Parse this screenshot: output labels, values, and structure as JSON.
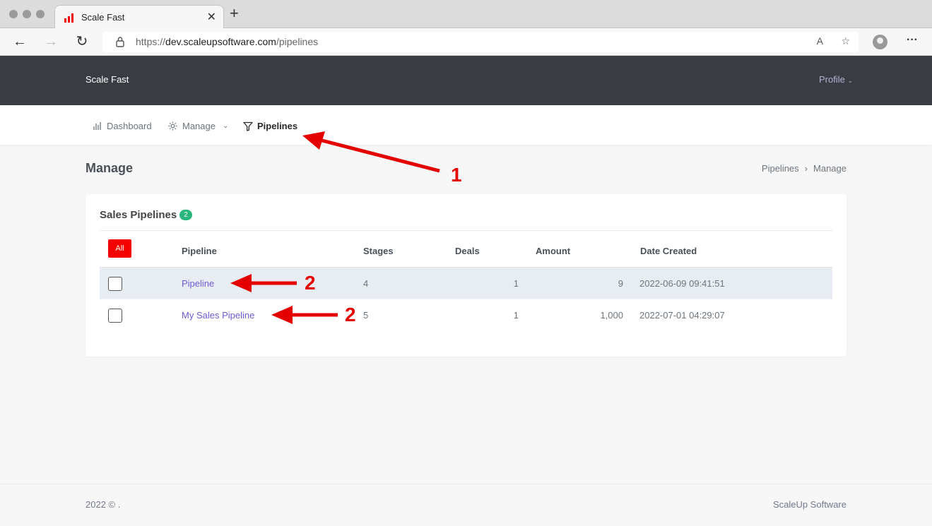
{
  "browser": {
    "tab_title": "Scale Fast",
    "url_prefix": "https://",
    "url_domain": "dev.scaleupsoftware.com",
    "url_path": "/pipelines"
  },
  "header": {
    "brand": "Scale Fast",
    "profile_label": "Profile"
  },
  "menu": {
    "items": [
      {
        "label": "Dashboard",
        "icon": "bar-chart-icon"
      },
      {
        "label": "Manage",
        "icon": "gear-icon"
      },
      {
        "label": "Pipelines",
        "icon": "filter-icon"
      }
    ]
  },
  "page": {
    "title": "Manage",
    "breadcrumb": [
      "Pipelines",
      "Manage"
    ]
  },
  "card": {
    "title": "Sales Pipelines",
    "badge_count": "2",
    "all_button": "All",
    "columns": [
      "Pipeline",
      "Stages",
      "Deals",
      "Amount",
      "Date Created"
    ],
    "rows": [
      {
        "pipeline": "Pipeline",
        "stages": "4",
        "deals": "1",
        "amount": "9",
        "date": "2022-06-09 09:41:51"
      },
      {
        "pipeline": "My Sales Pipeline",
        "stages": "5",
        "deals": "1",
        "amount": "1,000",
        "date": "2022-07-01 04:29:07"
      }
    ]
  },
  "annotations": [
    "1",
    "2",
    "2"
  ],
  "footer": {
    "left": "2022 © .",
    "right": "ScaleUp Software"
  },
  "colors": {
    "accent": "#f40000",
    "link": "#6f5bd1",
    "badge": "#2ab57d",
    "topbar": "#393c43",
    "annotation": "#e50000"
  }
}
